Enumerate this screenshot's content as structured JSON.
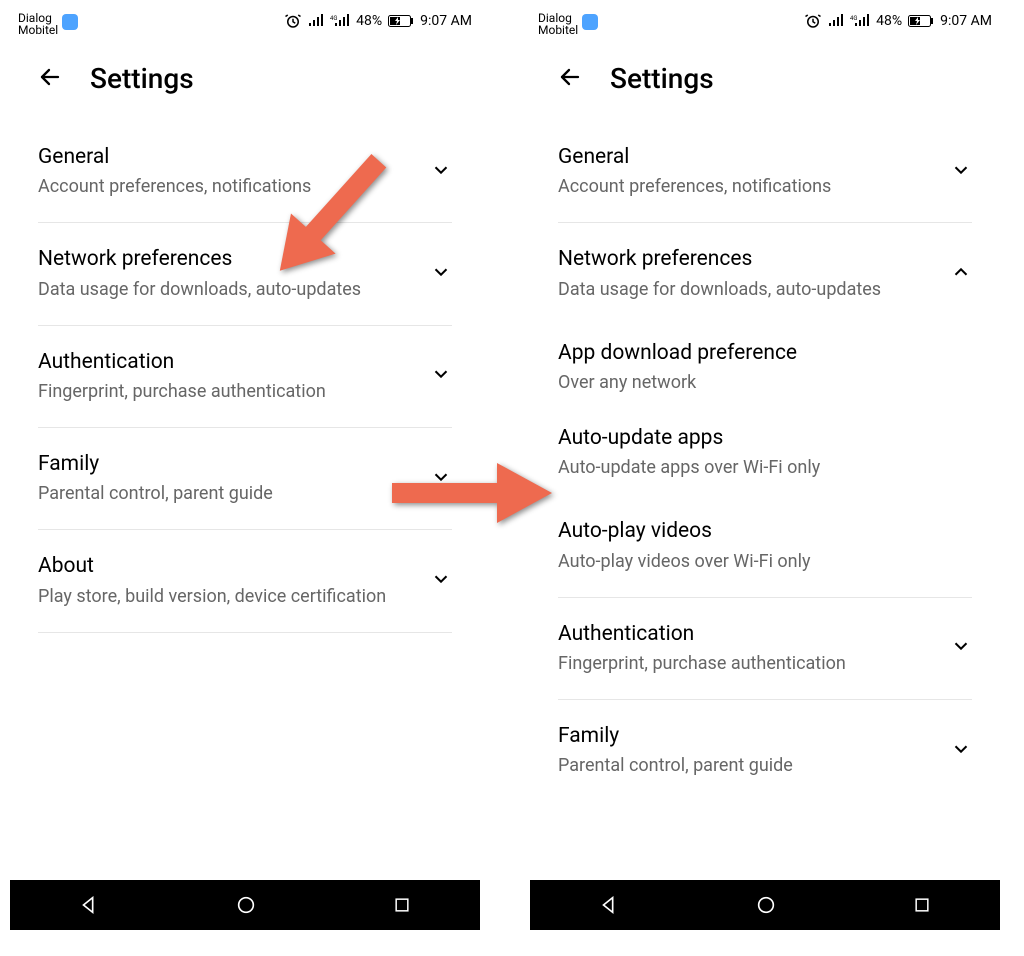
{
  "status": {
    "carrier1": "Dialog",
    "carrier2": "Mobitel",
    "battery_pct": "48%",
    "time": "9:07 AM"
  },
  "header": {
    "title": "Settings"
  },
  "left": {
    "items": [
      {
        "title": "General",
        "sub": "Account preferences, notifications",
        "expand": "down"
      },
      {
        "title": "Network preferences",
        "sub": "Data usage for downloads, auto-updates",
        "expand": "down"
      },
      {
        "title": "Authentication",
        "sub": "Fingerprint, purchase authentication",
        "expand": "down"
      },
      {
        "title": "Family",
        "sub": "Parental control, parent guide",
        "expand": "down"
      },
      {
        "title": "About",
        "sub": "Play store, build version, device certification",
        "expand": "down"
      }
    ]
  },
  "right": {
    "items": [
      {
        "title": "General",
        "sub": "Account preferences, notifications",
        "expand": "down",
        "type": "section"
      },
      {
        "title": "Network preferences",
        "sub": "Data usage for downloads, auto-updates",
        "expand": "up",
        "type": "section"
      },
      {
        "title": "App download preference",
        "sub": "Over any network",
        "type": "sub"
      },
      {
        "title": "Auto-update apps",
        "sub": "Auto-update apps over Wi-Fi only",
        "type": "sub"
      },
      {
        "title": "Auto-play videos",
        "sub": "Auto-play videos over Wi-Fi only",
        "type": "sub",
        "last_sub": true
      },
      {
        "title": "Authentication",
        "sub": "Fingerprint, purchase authentication",
        "expand": "down",
        "type": "section"
      },
      {
        "title": "Family",
        "sub": "Parental control, parent guide",
        "expand": "down",
        "type": "section"
      }
    ]
  },
  "annotations": {
    "arrow_color": "#ee6a4f"
  }
}
